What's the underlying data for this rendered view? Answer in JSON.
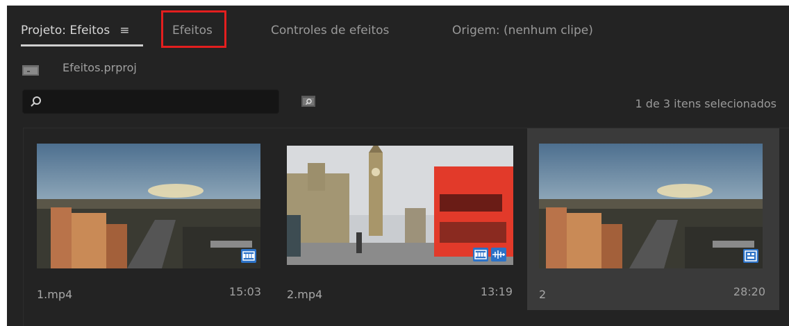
{
  "tabs": [
    {
      "label": "Projeto: Efeitos",
      "active": true
    },
    {
      "label": "Efeitos",
      "active": false,
      "highlighted": true
    },
    {
      "label": "Controles de efeitos",
      "active": false
    },
    {
      "label": "Origem: (nenhum clipe)",
      "active": false
    }
  ],
  "menu_icon": "≡",
  "project": {
    "file": "Efeitos.prproj"
  },
  "search": {
    "placeholder": "",
    "value": ""
  },
  "selection_count": "1 de 3 itens selecionados",
  "clips": [
    {
      "name": "1.mp4",
      "duration": "15:03",
      "selected": false,
      "badges": [
        "video-clip-icon"
      ]
    },
    {
      "name": "2.mp4",
      "duration": "13:19",
      "selected": false,
      "badges": [
        "video-clip-icon",
        "audio-clip-icon"
      ]
    },
    {
      "name": "2",
      "duration": "28:20",
      "selected": true,
      "badges": [
        "sequence-icon"
      ]
    }
  ],
  "colors": {
    "panel_bg": "#232323",
    "highlight": "#e31e1e",
    "badge": "#2c72c7",
    "selected_bg": "#3a3a3a"
  }
}
